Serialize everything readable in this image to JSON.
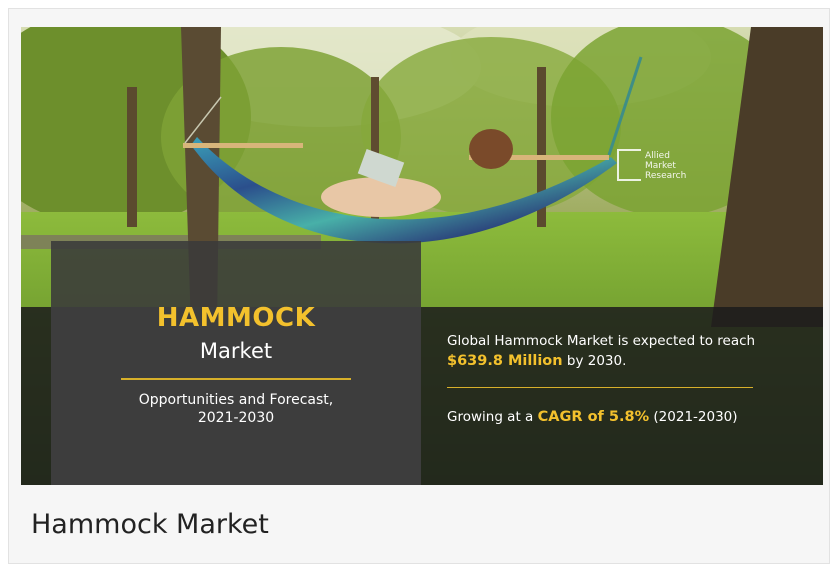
{
  "banner": {
    "title": "HAMMOCK",
    "subtitle": "Market",
    "description_line1": "Opportunities and Forecast,",
    "description_line2": "2021-2030",
    "stat1_prefix": "Global Hammock Market is expected to reach",
    "stat1_value": "$639.8 Million",
    "stat1_suffix": " by 2030.",
    "stat2_prefix": "Growing at a ",
    "stat2_value": "CAGR of 5.8%",
    "stat2_suffix": " (2021-2030)",
    "logo_lines": [
      "Allied",
      "Market",
      "Research"
    ]
  },
  "caption": "Hammock Market",
  "colors": {
    "accent_yellow": "#f3c12d",
    "panel_dark": "#3a3a3a",
    "text_white": "#ffffff"
  }
}
